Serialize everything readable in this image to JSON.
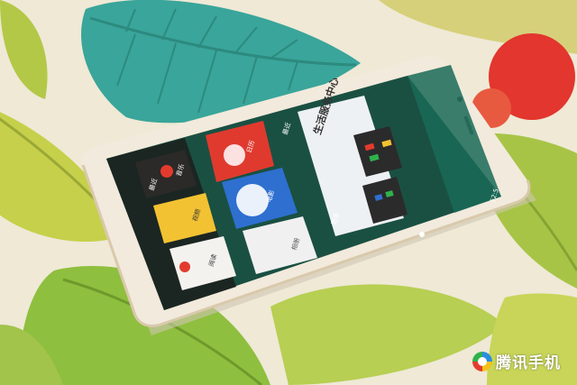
{
  "screen": {
    "service_center_title": "生活服务中心",
    "app_labels": [
      "日历",
      "电影",
      "相册",
      "音乐",
      "视频",
      "阅读"
    ],
    "side_labels": [
      "最近",
      "最近",
      "更多"
    ],
    "widget_clock": "1",
    "status_time": "52:5"
  },
  "watermark": {
    "text": "腾讯手机"
  },
  "colors": {
    "tablecloth": "#efe9d6",
    "leaf_green": "#a9c84a",
    "leaf_teal": "#3aa59a",
    "red_dot": "#e2362e",
    "phone_body": "#f2eadc",
    "screen_bg": "#1e5a4a"
  }
}
